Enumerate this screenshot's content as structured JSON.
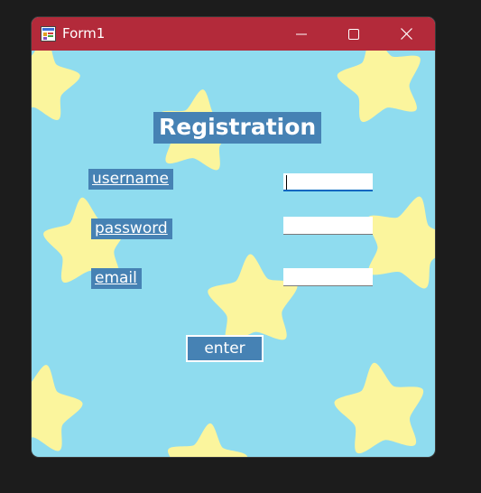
{
  "window": {
    "title": "Form1",
    "icons": {
      "app": "form-app-icon",
      "minimize": "minimize-icon",
      "maximize": "maximize-icon",
      "close": "close-icon"
    }
  },
  "form": {
    "heading": "Registration",
    "username_label": "username",
    "password_label": "password",
    "email_label": "email",
    "username_value": "",
    "password_value": "",
    "email_value": "",
    "enter_label": "enter"
  },
  "colors": {
    "titlebar": "#b32a3a",
    "background": "#8fdcef",
    "star": "#fbf59d",
    "label_background": "#4682b4",
    "text": "#ffffff"
  }
}
